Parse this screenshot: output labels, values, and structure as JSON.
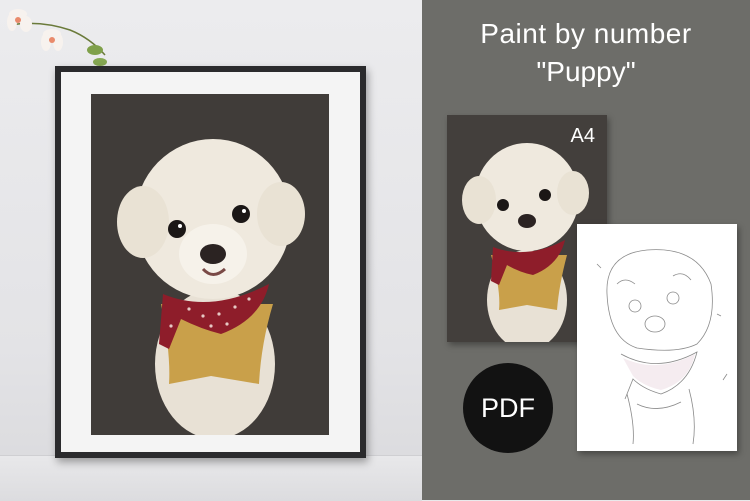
{
  "product": {
    "title_line1": "Paint by number",
    "title_line2": "\"Puppy\""
  },
  "preview": {
    "size_label": "A4",
    "format_badge": "PDF"
  },
  "colors": {
    "panel_background": "#6d6d69",
    "art_background": "#403c39",
    "badge_background": "#121212",
    "bandana_red": "#8e1d2a",
    "vest_yellow": "#c9a04a",
    "fur_white": "#efe9de"
  },
  "icons": [
    "flowers-icon",
    "puppy-painting-icon",
    "puppy-outline-icon"
  ]
}
